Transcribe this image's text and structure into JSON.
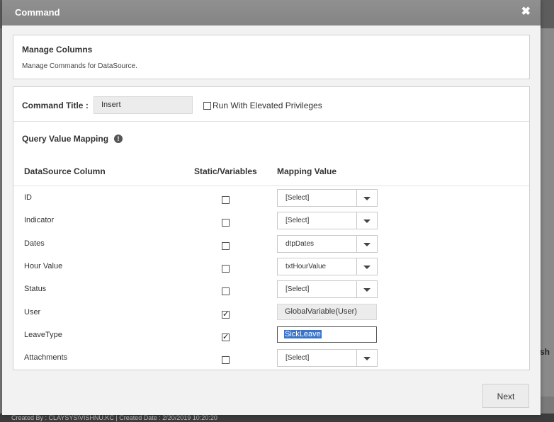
{
  "dialog": {
    "title": "Command",
    "close_glyph": "✖"
  },
  "manage_columns": {
    "heading": "Manage Columns",
    "description": "Manage Commands for DataSource."
  },
  "command": {
    "title_label": "Command Title",
    "title_colon": ":",
    "title_value": "Insert",
    "elevated_label": "Run With Elevated Privileges",
    "elevated_checked": false
  },
  "mapping": {
    "heading": "Query Value Mapping",
    "info_glyph": "!",
    "headers": {
      "column": "DataSource Column",
      "static": "Static/Variables",
      "value": "Mapping Value"
    },
    "rows": [
      {
        "name": "ID",
        "checked": false,
        "kind": "select",
        "value": "[Select]"
      },
      {
        "name": "Indicator",
        "checked": false,
        "kind": "select",
        "value": "[Select]"
      },
      {
        "name": "Dates",
        "checked": false,
        "kind": "select",
        "value": "dtpDates"
      },
      {
        "name": "Hour Value",
        "checked": false,
        "kind": "select",
        "value": "txtHourValue"
      },
      {
        "name": "Status",
        "checked": false,
        "kind": "select",
        "value": "[Select]"
      },
      {
        "name": "User",
        "checked": true,
        "kind": "readonly",
        "value": "GlobalVariable(User)"
      },
      {
        "name": "LeaveType",
        "checked": true,
        "kind": "text",
        "value": "SickLeave"
      },
      {
        "name": "Attachments",
        "checked": false,
        "kind": "select",
        "value": "[Select]"
      }
    ]
  },
  "footer": {
    "next_label": "Next"
  },
  "background": {
    "footer_text": "Created By : CLAYSYS\\VISHNU.KC | Created Date : 2/20/2019 10:20:20",
    "right_fragment": "sh"
  }
}
